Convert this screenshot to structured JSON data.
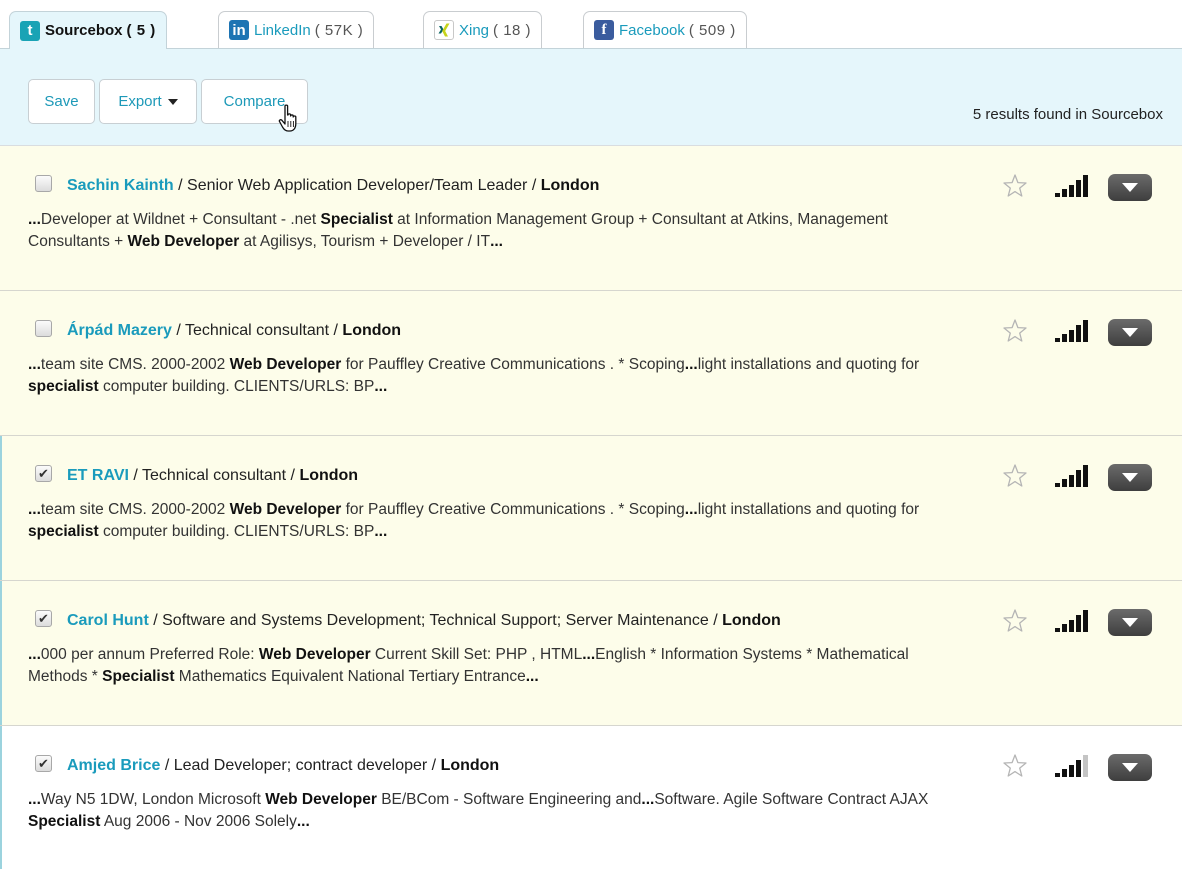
{
  "tabs": [
    {
      "label": "Sourcebox",
      "count": "( 5 )",
      "icon": "sourcebox-icon",
      "glyph": "t",
      "active": true
    },
    {
      "label": "LinkedIn",
      "count": "( 57K )",
      "icon": "linkedin-icon",
      "glyph": "in",
      "active": false
    },
    {
      "label": "Xing",
      "count": "( 18 )",
      "icon": "xing-icon",
      "glyph": "",
      "active": false
    },
    {
      "label": "Facebook",
      "count": "( 509 )",
      "icon": "facebook-icon",
      "glyph": "f",
      "active": false
    }
  ],
  "toolbar": {
    "save_label": "Save",
    "export_label": "Export",
    "compare_label": "Compare",
    "results_text": "5 results found in Sourcebox"
  },
  "results": [
    {
      "name": "Sachin Kainth",
      "title": "Senior Web Application Developer/Team Leader",
      "location": "London",
      "checked": false,
      "signal": 5,
      "snippet_parts": [
        {
          "t": "...",
          "b": true
        },
        {
          "t": "Developer at Wildnet + Consultant - .net ",
          "b": false
        },
        {
          "t": "Specialist",
          "b": true
        },
        {
          "t": " at Information Management Group + Consultant at Atkins, Management Consultants + ",
          "b": false
        },
        {
          "t": "Web Developer",
          "b": true
        },
        {
          "t": " at Agilisys, Tourism + Developer / IT",
          "b": false
        },
        {
          "t": "...",
          "b": true
        }
      ]
    },
    {
      "name": "Árpád Mazery",
      "title": "Technical consultant",
      "location": "London",
      "checked": false,
      "signal": 5,
      "snippet_parts": [
        {
          "t": "...",
          "b": true
        },
        {
          "t": "team site CMS. 2000-2002 ",
          "b": false
        },
        {
          "t": "Web Developer",
          "b": true
        },
        {
          "t": " for Pauffley Creative Communications . * Scoping",
          "b": false
        },
        {
          "t": "...",
          "b": true
        },
        {
          "t": "light installations and quoting for ",
          "b": false
        },
        {
          "t": "specialist",
          "b": true
        },
        {
          "t": " computer building. CLIENTS/URLS: BP",
          "b": false
        },
        {
          "t": "...",
          "b": true
        }
      ]
    },
    {
      "name": "ET RAVI",
      "title": "Technical consultant",
      "location": "London",
      "checked": true,
      "signal": 5,
      "snippet_parts": [
        {
          "t": "...",
          "b": true
        },
        {
          "t": "team site CMS. 2000-2002 ",
          "b": false
        },
        {
          "t": "Web Developer",
          "b": true
        },
        {
          "t": " for Pauffley Creative Communications . * Scoping",
          "b": false
        },
        {
          "t": "...",
          "b": true
        },
        {
          "t": "light installations and quoting for ",
          "b": false
        },
        {
          "t": "specialist",
          "b": true
        },
        {
          "t": " computer building. CLIENTS/URLS: BP",
          "b": false
        },
        {
          "t": "...",
          "b": true
        }
      ]
    },
    {
      "name": "Carol Hunt",
      "title": "Software and Systems Development; Technical Support; Server Maintenance",
      "location": "London",
      "checked": true,
      "signal": 5,
      "snippet_parts": [
        {
          "t": "...",
          "b": true
        },
        {
          "t": "000 per annum Preferred Role: ",
          "b": false
        },
        {
          "t": "Web Developer",
          "b": true
        },
        {
          "t": " Current Skill Set: PHP , HTML",
          "b": false
        },
        {
          "t": "...",
          "b": true
        },
        {
          "t": "English * Information Systems * Mathematical Methods * ",
          "b": false
        },
        {
          "t": "Specialist",
          "b": true
        },
        {
          "t": " Mathematics Equivalent National Tertiary Entrance",
          "b": false
        },
        {
          "t": "...",
          "b": true
        }
      ]
    },
    {
      "name": "Amjed Brice",
      "title": "Lead Developer; contract developer",
      "location": "London",
      "checked": true,
      "signal": 4,
      "snippet_parts": [
        {
          "t": "...",
          "b": true
        },
        {
          "t": "Way N5 1DW, London Microsoft ",
          "b": false
        },
        {
          "t": "Web Developer",
          "b": true
        },
        {
          "t": " BE/BCom - Software Engineering and",
          "b": false
        },
        {
          "t": "...",
          "b": true
        },
        {
          "t": "Software. Agile Software Contract AJAX ",
          "b": false
        },
        {
          "t": "Specialist",
          "b": true
        },
        {
          "t": " Aug 2006 - Nov 2006 Solely",
          "b": false
        },
        {
          "t": "...",
          "b": true
        }
      ]
    }
  ],
  "colors": {
    "accent": "#1a9bbc",
    "toolbar_bg": "#e5f6fb",
    "row_bg": "#fdfdea"
  }
}
